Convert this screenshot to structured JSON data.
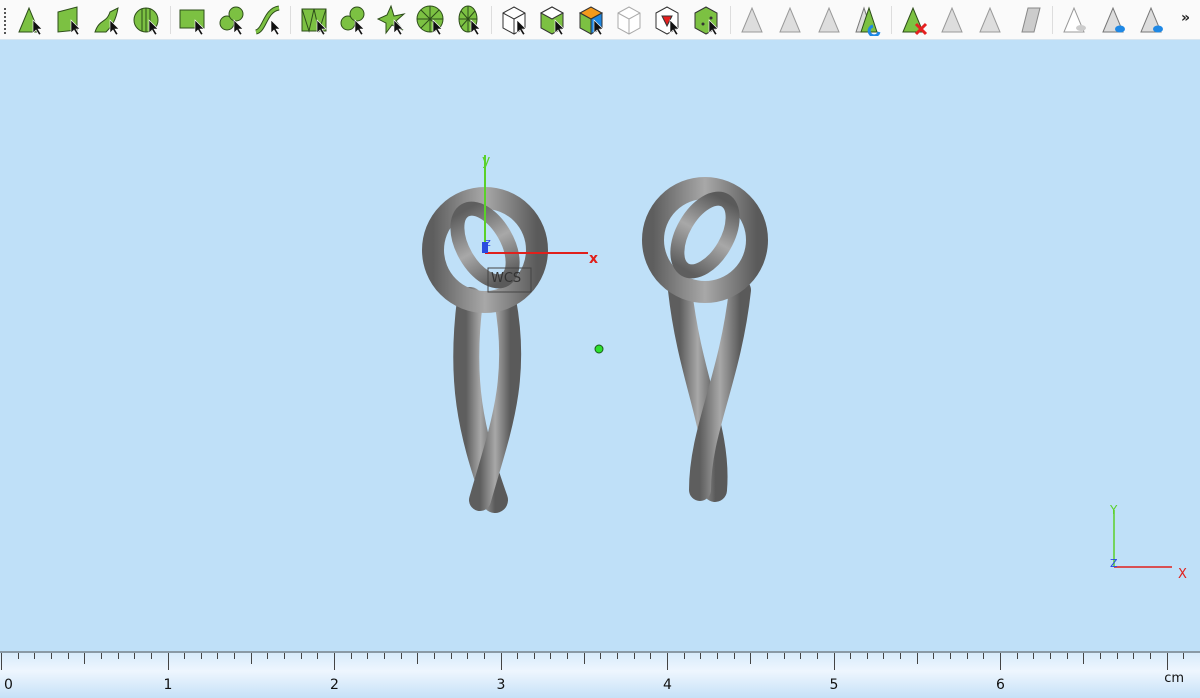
{
  "toolbar": {
    "items": [
      {
        "name": "select-vertex",
        "kind": "triangle"
      },
      {
        "name": "select-face",
        "kind": "quad"
      },
      {
        "name": "select-surface",
        "kind": "surface"
      },
      {
        "name": "select-shell",
        "kind": "shell"
      },
      {
        "name": "select-rectangle",
        "kind": "rect"
      },
      {
        "name": "select-blob",
        "kind": "blob"
      },
      {
        "name": "select-curve",
        "kind": "curve"
      },
      {
        "name": "select-triangles",
        "kind": "tris"
      },
      {
        "name": "select-patch",
        "kind": "blob"
      },
      {
        "name": "select-star",
        "kind": "star"
      },
      {
        "name": "select-wheel",
        "kind": "wheel"
      },
      {
        "name": "select-oval",
        "kind": "oval"
      },
      {
        "name": "select-part",
        "kind": "cube-white"
      },
      {
        "name": "select-part-green",
        "kind": "cube-green"
      },
      {
        "name": "select-part-orange",
        "kind": "cube-orange"
      },
      {
        "name": "select-part-ghost",
        "kind": "cube-ghost"
      },
      {
        "name": "select-part-inner",
        "kind": "cube-red"
      },
      {
        "name": "select-part-solid",
        "kind": "cube-solid"
      },
      {
        "name": "select-triangle-gray",
        "kind": "gray-tri"
      },
      {
        "name": "select-shrink",
        "kind": "gray-tri"
      },
      {
        "name": "select-grow",
        "kind": "gray-tri"
      },
      {
        "name": "invert-selection",
        "kind": "tri-blue"
      },
      {
        "name": "delete-selection",
        "kind": "tri-x"
      },
      {
        "name": "split-selection",
        "kind": "gray-tri"
      },
      {
        "name": "copy-selection",
        "kind": "gray-tri"
      },
      {
        "name": "flatten-selection",
        "kind": "gray-quad"
      },
      {
        "name": "hide-selection",
        "kind": "tri-eye"
      },
      {
        "name": "show-selection",
        "kind": "tri-eye-blue"
      },
      {
        "name": "show-all",
        "kind": "tri-eye-blue"
      }
    ],
    "more_label": "»"
  },
  "viewport": {
    "wcs_label": "WCS",
    "axis_x": "x",
    "axis_y": "y",
    "axis_z": "z",
    "corner_x": "X",
    "corner_y": "Y",
    "corner_z": "Z",
    "colors": {
      "background": "#bfe0f8",
      "model": "#8c8c8c",
      "x_axis": "#e0201c",
      "y_axis": "#5ad12a",
      "z_axis": "#2a4adf"
    }
  },
  "ruler": {
    "labels": [
      "0",
      "1",
      "2",
      "3",
      "4",
      "5",
      "6"
    ],
    "unit": "cm"
  }
}
